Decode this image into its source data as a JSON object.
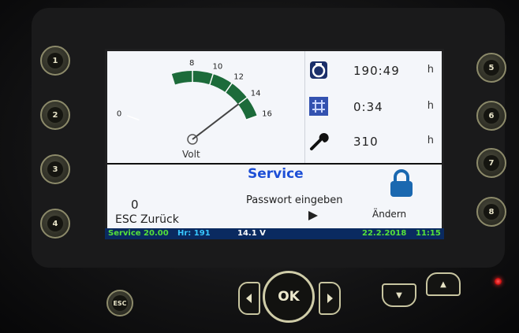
{
  "side_buttons": {
    "left": [
      "1",
      "2",
      "3",
      "4"
    ],
    "right": [
      "5",
      "6",
      "7",
      "8"
    ]
  },
  "gauge": {
    "ticks": [
      "0",
      "8",
      "10",
      "12",
      "14",
      "16"
    ],
    "unit": "Volt",
    "value": 14,
    "accent": "#1c6b3a"
  },
  "hours": [
    {
      "icon": "engine-icon",
      "value": "190:49",
      "unit": "h"
    },
    {
      "icon": "sensor-icon",
      "value": "0:34",
      "unit": "h"
    },
    {
      "icon": "wrench-icon",
      "value": "310",
      "unit": "h"
    }
  ],
  "service": {
    "title": "Service",
    "value": "0",
    "prompt": "Passwort eingeben",
    "back_label": "ESC Zurück",
    "change_label": "Ändern",
    "title_color": "#1d4fd6"
  },
  "status_bar": {
    "left1": "Service 20.00",
    "left2": "Hr: 191",
    "voltage": "14.1 V",
    "date": "22.2.2018",
    "time": "11:15"
  },
  "controls": {
    "esc": "ESC",
    "ok": "OK",
    "up": "▲",
    "down": "▼"
  }
}
